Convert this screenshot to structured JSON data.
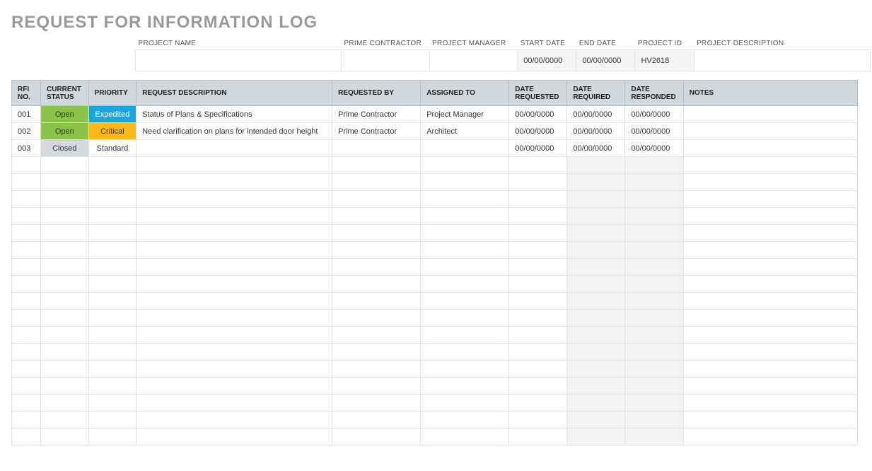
{
  "title": "REQUEST FOR INFORMATION LOG",
  "meta": {
    "labels": {
      "project_name": "PROJECT NAME",
      "prime_contractor": "PRIME CONTRACTOR",
      "project_manager": "PROJECT MANAGER",
      "start_date": "START DATE",
      "end_date": "END DATE",
      "project_id": "PROJECT ID",
      "project_description": "PROJECT DESCRIPTION"
    },
    "values": {
      "project_name": "",
      "prime_contractor": "",
      "project_manager": "",
      "start_date": "00/00/0000",
      "end_date": "00/00/0000",
      "project_id": "HV2618",
      "project_description": ""
    }
  },
  "log": {
    "headers": {
      "rfi_no": "RFI NO.",
      "current_status": "CURRENT STATUS",
      "priority": "PRIORITY",
      "request_description": "REQUEST DESCRIPTION",
      "requested_by": "REQUESTED BY",
      "assigned_to": "ASSIGNED TO",
      "date_requested": "DATE REQUESTED",
      "date_required": "DATE REQUIRED",
      "date_responded": "DATE RESPONDED",
      "notes": "NOTES"
    },
    "rows": [
      {
        "rfi_no": "001",
        "status": "Open",
        "status_key": "open",
        "priority": "Expedited",
        "priority_key": "expedited",
        "description": "Status of Plans & Specifications",
        "requested_by": "Prime Contractor",
        "assigned_to": "Project Manager",
        "date_requested": "00/00/0000",
        "date_required": "00/00/0000",
        "date_responded": "00/00/0000",
        "notes": ""
      },
      {
        "rfi_no": "002",
        "status": "Open",
        "status_key": "open",
        "priority": "Critical",
        "priority_key": "critical",
        "description": "Need clarification on plans for intended door height",
        "requested_by": "Prime Contractor",
        "assigned_to": "Architect",
        "date_requested": "00/00/0000",
        "date_required": "00/00/0000",
        "date_responded": "00/00/0000",
        "notes": ""
      },
      {
        "rfi_no": "003",
        "status": "Closed",
        "status_key": "closed",
        "priority": "Standard",
        "priority_key": "standard",
        "description": "",
        "requested_by": "",
        "assigned_to": "",
        "date_requested": "00/00/0000",
        "date_required": "00/00/0000",
        "date_responded": "00/00/0000",
        "notes": ""
      }
    ],
    "empty_rows": 17
  },
  "colors": {
    "header_bg": "#d0d7dd",
    "status_open": "#8bc34a",
    "status_closed": "#d5d9dd",
    "priority_expedited": "#17a7e0",
    "priority_critical": "#fdb915"
  }
}
